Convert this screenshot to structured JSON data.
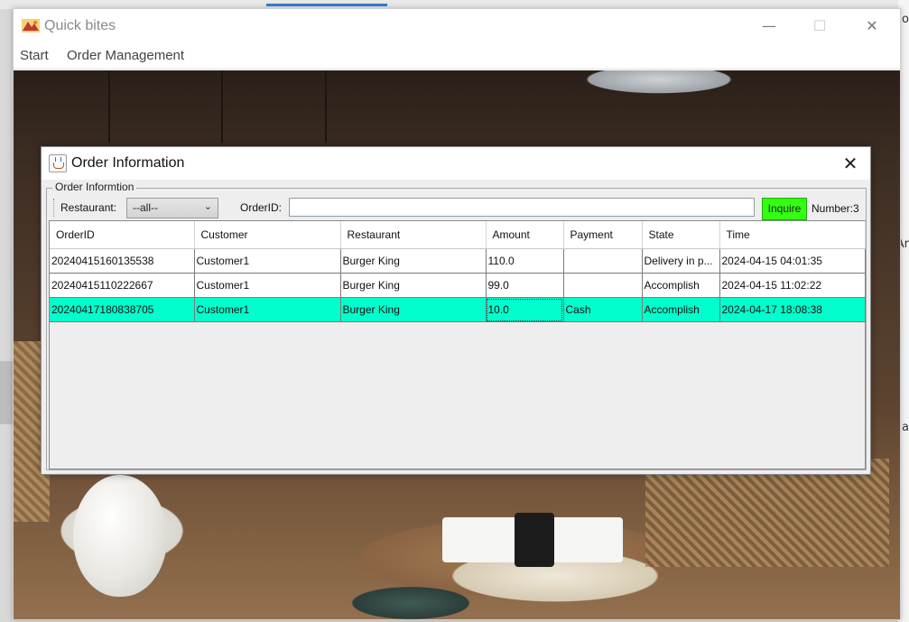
{
  "app": {
    "title": "Quick bites",
    "controls": {
      "minimize": "—",
      "maximize": "☐",
      "close": "✕"
    },
    "menu": [
      "Start",
      "Order Management"
    ]
  },
  "desktop": {
    "right_fragments": [
      "do",
      "Ar",
      "Na"
    ]
  },
  "dialog": {
    "title": "Order Information",
    "close": "✕",
    "group_title": "Order Informtion",
    "filters": {
      "restaurant_label": "Restaurant:",
      "restaurant_value": "--all--",
      "orderid_label": "OrderID:",
      "orderid_value": "",
      "inquire_label": "Inquire",
      "count_text": "Number:3"
    },
    "table": {
      "columns": [
        "OrderID",
        "Customer",
        "Restaurant",
        "Amount",
        "Payment",
        "State",
        "Time"
      ],
      "rows": [
        [
          "20240415160135538",
          "Customer1",
          "Burger King",
          "110.0",
          "",
          "Delivery in p...",
          "2024-04-15 04:01:35"
        ],
        [
          "20240415110222667",
          "Customer1",
          "Burger King",
          "99.0",
          "",
          "Accomplish",
          "2024-04-15 11:02:22"
        ],
        [
          "20240417180838705",
          "Customer1",
          "Burger King",
          "10.0",
          "Cash",
          "Accomplish",
          "2024-04-17 18:08:38"
        ]
      ],
      "selected_row": 2
    }
  },
  "colors": {
    "inquire_bg": "#33ff11",
    "selected_row_bg": "#00ffcc"
  }
}
